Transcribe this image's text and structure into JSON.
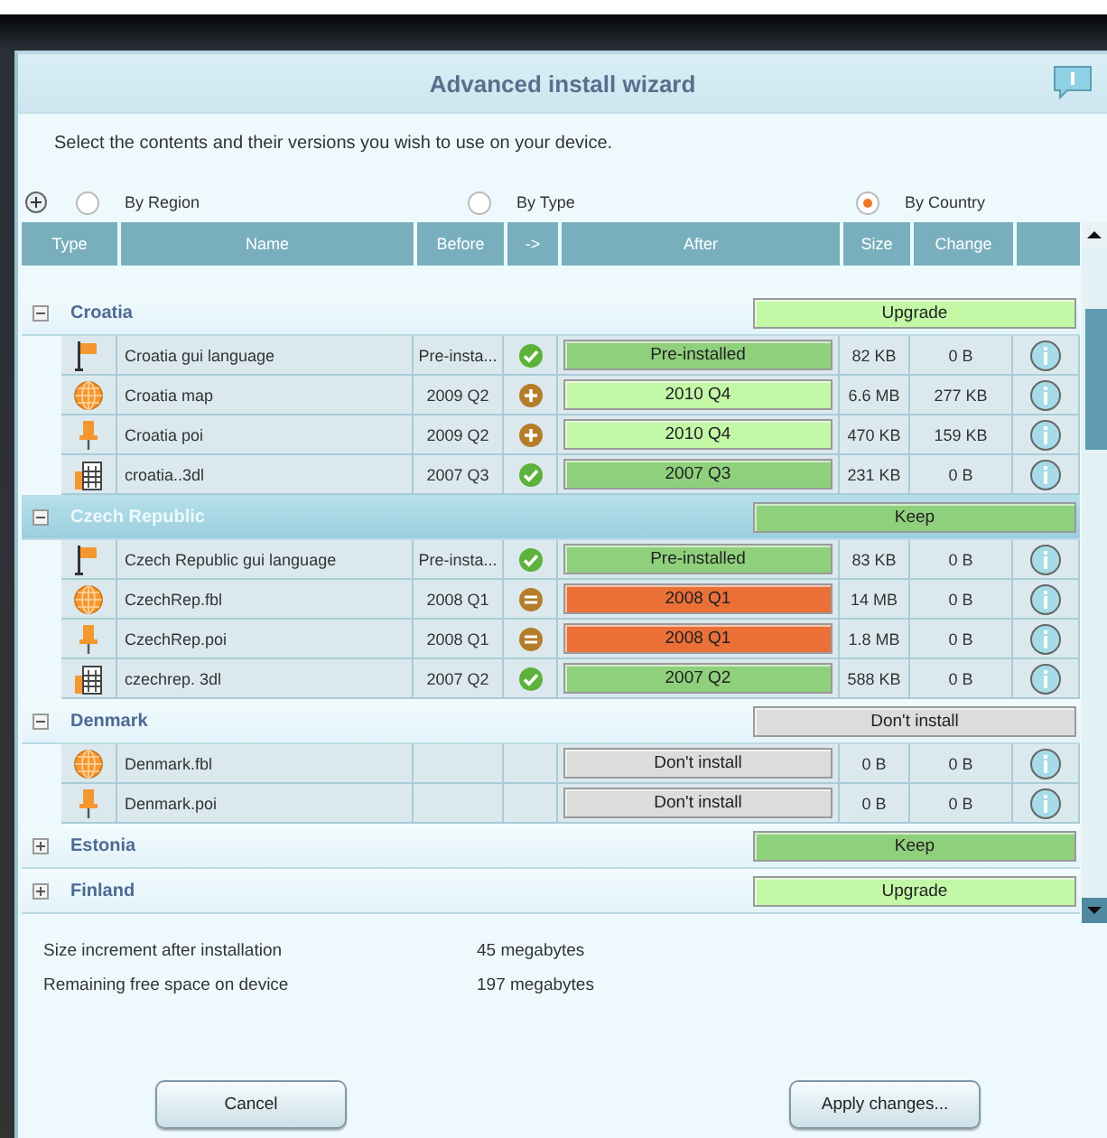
{
  "window": {
    "title": "Advanced install wizard"
  },
  "instruction": "Select the contents and their versions you wish to use on your device.",
  "view_options": [
    {
      "label": "By Region",
      "selected": false
    },
    {
      "label": "By Type",
      "selected": false
    },
    {
      "label": "By Country",
      "selected": true
    }
  ],
  "table": {
    "columns": [
      "Type",
      "Name",
      "Before",
      "->",
      "After",
      "Size",
      "Change",
      ""
    ],
    "groups": [
      {
        "name": "Croatia",
        "expanded": true,
        "selected": false,
        "action": {
          "label": "Upgrade",
          "kind": "upgrade"
        },
        "children": [
          {
            "kind": "flag",
            "name": "Croatia gui language",
            "before": "Pre-insta...",
            "status": {
              "kind": "check"
            },
            "after": {
              "label": "Pre-installed",
              "kind": "keep"
            },
            "size": "82 KB",
            "change": "0 B"
          },
          {
            "kind": "globe",
            "name": "Croatia map",
            "before": "2009 Q2",
            "status": {
              "kind": "plus"
            },
            "after": {
              "label": "2010 Q4",
              "kind": "upgrade"
            },
            "size": "6.6 MB",
            "change": "277 KB"
          },
          {
            "kind": "pin",
            "name": "Croatia poi",
            "before": "2009 Q2",
            "status": {
              "kind": "plus"
            },
            "after": {
              "label": "2010 Q4",
              "kind": "upgrade"
            },
            "size": "470 KB",
            "change": "159 KB"
          },
          {
            "kind": "building",
            "name": "croatia..3dl",
            "before": "2007 Q3",
            "status": {
              "kind": "check"
            },
            "after": {
              "label": "2007 Q3",
              "kind": "keep"
            },
            "size": "231 KB",
            "change": "0 B"
          }
        ]
      },
      {
        "name": "Czech Republic",
        "expanded": true,
        "selected": true,
        "action": {
          "label": "Keep",
          "kind": "keep"
        },
        "children": [
          {
            "kind": "flag",
            "name": "Czech Republic gui language",
            "before": "Pre-insta...",
            "status": {
              "kind": "check"
            },
            "after": {
              "label": "Pre-installed",
              "kind": "keep"
            },
            "size": "83 KB",
            "change": "0 B"
          },
          {
            "kind": "globe",
            "name": "CzechRep.fbl",
            "before": "2008 Q1",
            "status": {
              "kind": "minus"
            },
            "after": {
              "label": "2008 Q1",
              "kind": "downgrade"
            },
            "size": "14 MB",
            "change": "0 B"
          },
          {
            "kind": "pin",
            "name": "CzechRep.poi",
            "before": "2008 Q1",
            "status": {
              "kind": "minus"
            },
            "after": {
              "label": "2008 Q1",
              "kind": "downgrade"
            },
            "size": "1.8 MB",
            "change": "0 B"
          },
          {
            "kind": "building",
            "name": "czechrep. 3dl",
            "before": "2007 Q2",
            "status": {
              "kind": "check"
            },
            "after": {
              "label": "2007 Q2",
              "kind": "keep"
            },
            "size": "588 KB",
            "change": "0 B"
          }
        ]
      },
      {
        "name": "Denmark",
        "expanded": true,
        "selected": false,
        "action": {
          "label": "Don't install",
          "kind": "none"
        },
        "children": [
          {
            "kind": "globe",
            "name": "Denmark.fbl",
            "after": {
              "label": "Don't install",
              "kind": "none"
            },
            "size": "0 B",
            "change": "0 B"
          },
          {
            "kind": "pin",
            "name": "Denmark.poi",
            "after": {
              "label": "Don't install",
              "kind": "none"
            },
            "size": "0 B",
            "change": "0 B"
          }
        ]
      },
      {
        "name": "Estonia",
        "expanded": false,
        "selected": false,
        "action": {
          "label": "Keep",
          "kind": "keep"
        }
      },
      {
        "name": "Finland",
        "expanded": false,
        "selected": false,
        "action": {
          "label": "Upgrade",
          "kind": "upgrade"
        }
      }
    ]
  },
  "summary": [
    {
      "label": "Size increment after installation",
      "value": "45 megabytes"
    },
    {
      "label": "Remaining free space on device",
      "value": "197 megabytes"
    }
  ],
  "buttons": [
    "Cancel",
    "Apply changes..."
  ]
}
